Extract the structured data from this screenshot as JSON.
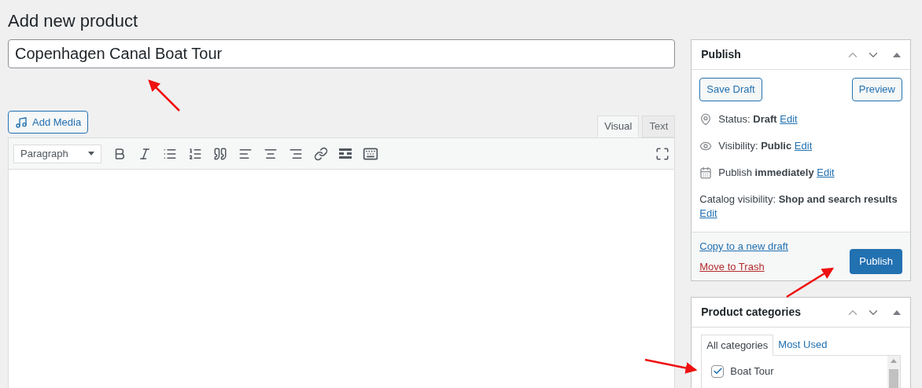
{
  "page_title": "Add new product",
  "product_title": {
    "value": "Copenhagen Canal Boat Tour"
  },
  "add_media": "Add Media",
  "editor_tabs": [
    {
      "label": "Visual",
      "selected": true
    },
    {
      "label": "Text",
      "selected": false
    }
  ],
  "format_select": "Paragraph",
  "publish": {
    "title": "Publish",
    "save_draft": "Save Draft",
    "preview": "Preview",
    "rows": [
      {
        "kind": "status",
        "text": "Status: **Draft**",
        "link": "Edit"
      },
      {
        "kind": "visibility",
        "text": "Visibility: **Public**",
        "link": "Edit"
      },
      {
        "kind": "schedule",
        "text": "Publish **immediately**",
        "link": "Edit"
      },
      {
        "kind": "catalog",
        "text": "Catalog visibility: **Shop and search results**",
        "link": "Edit"
      }
    ],
    "copy_link": "Copy to a new draft",
    "trash_link": "Move to Trash",
    "publish_button": "Publish"
  },
  "categories": {
    "title": "Product categories",
    "tabs": [
      {
        "label": "All categories",
        "selected": true
      },
      {
        "label": "Most Used",
        "selected": false
      }
    ],
    "items": [
      {
        "label": "Boat Tour",
        "checked": true
      }
    ]
  }
}
